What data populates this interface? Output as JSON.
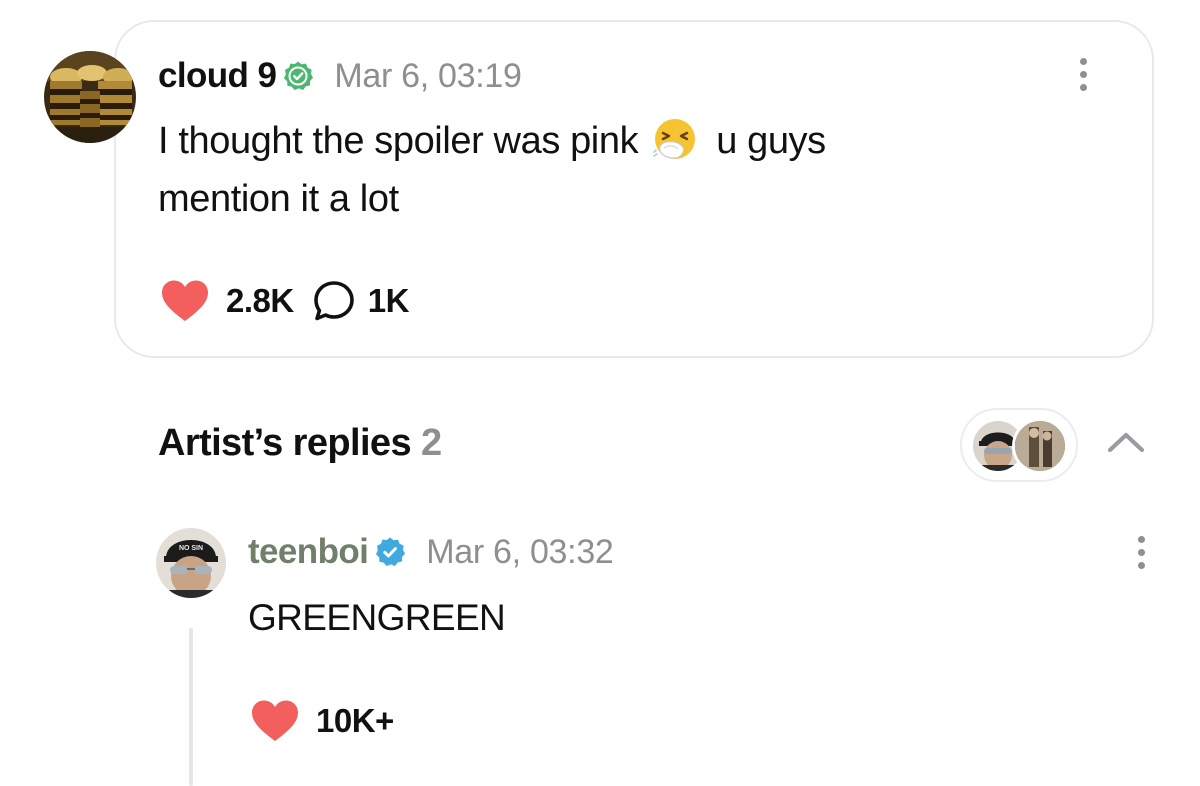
{
  "post": {
    "username": "cloud 9",
    "timestamp": "Mar 6, 03:19",
    "text_line1": "I thought the spoiler was pink",
    "text_after_emoji": "u guys",
    "text_line2": "mention it a lot",
    "emoji": "sneezing-face-icon",
    "likes": "2.8K",
    "comments": "1K",
    "verified_color": "#4cb86f"
  },
  "replies": {
    "heading": "Artist’s replies",
    "count": "2"
  },
  "reply": {
    "username": "teenboi",
    "timestamp": "Mar 6, 03:32",
    "text": "GREENGREEN",
    "likes": "10K+",
    "verified_color": "#3fa9e0"
  },
  "colors": {
    "heart": "#f25f5c",
    "muted": "#8e8e93",
    "reply_username": "#6f7f6a"
  }
}
